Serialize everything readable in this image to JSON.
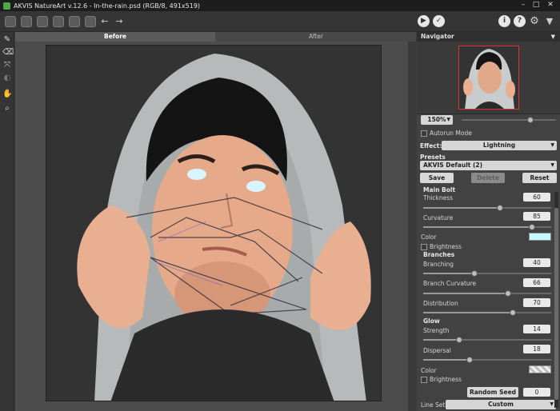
{
  "window": {
    "title": "AKVIS NatureArt v.12.6 - In-the-rain.psd (RGB/8, 491x519)"
  },
  "toolbar": {
    "back_icon": "arrow-left-icon",
    "forward_icon": "arrow-right-icon",
    "run_icon": "play-icon",
    "apply_icon": "check-icon",
    "info_icon": "info-icon",
    "help_icon": "help-icon",
    "settings_icon": "gear-icon",
    "feedback_icon": "feedback-icon"
  },
  "tabs": {
    "before": "Before",
    "after": "After"
  },
  "navigator": {
    "title": "Navigator",
    "zoom": "150%"
  },
  "autorun": {
    "label": "Autorun Mode"
  },
  "effect": {
    "label": "Effect:",
    "value": "Lightning"
  },
  "presets": {
    "label": "Presets",
    "value": "AKVIS Default (2)",
    "save": "Save",
    "delete": "Delete",
    "reset": "Reset"
  },
  "main_bolt": {
    "title": "Main Bolt",
    "thickness": {
      "label": "Thickness",
      "value": "60",
      "fraction": 0.6
    },
    "curvature": {
      "label": "Curvature",
      "value": "85",
      "fraction": 0.85
    },
    "color_label": "Color",
    "color": "#c9f8ff",
    "brightness": "Brightness"
  },
  "branches": {
    "title": "Branches",
    "branching": {
      "label": "Branching",
      "value": "40",
      "fraction": 0.4
    },
    "branch_curvature": {
      "label": "Branch Curvature",
      "value": "66",
      "fraction": 0.66
    },
    "distribution": {
      "label": "Distribution",
      "value": "70",
      "fraction": 0.7
    }
  },
  "glow": {
    "title": "Glow",
    "strength": {
      "label": "Strength",
      "value": "14",
      "fraction": 0.28
    },
    "dispersal": {
      "label": "Dispersal",
      "value": "18",
      "fraction": 0.36
    },
    "color_label": "Color",
    "brightness": "Brightness"
  },
  "random_seed": {
    "label": "Random Seed",
    "value": "0"
  },
  "line_set": {
    "label": "Line Set",
    "value": "Custom"
  },
  "colors": {
    "accent": "#2f2f2f",
    "panel": "#424242",
    "bolt": "#c9f8ff"
  }
}
